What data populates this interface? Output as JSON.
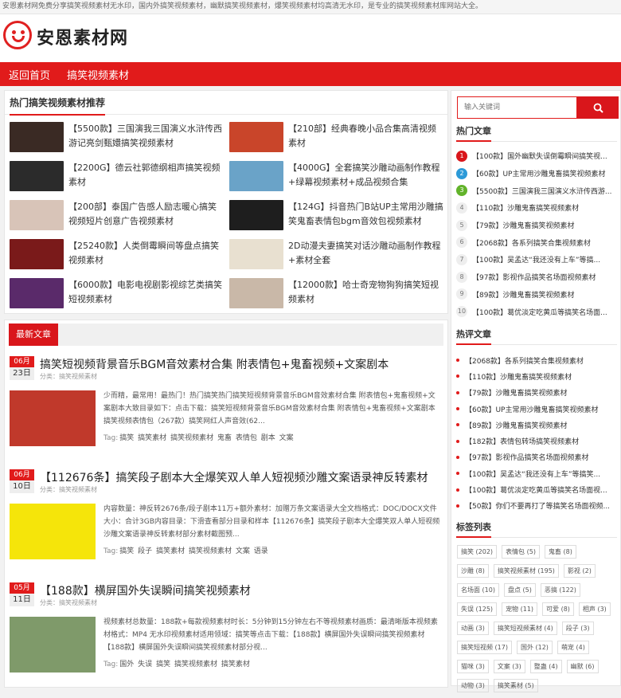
{
  "topbar": {
    "text": "安恩素材网免费分享搞笑视频素材无水印，国内外搞笑视频素材，幽默搞笑视频素材，爆笑视频素材均高清无水印，是专业的搞笑视频素材库网站大全。"
  },
  "header": {
    "logo_text": "安恩素材网"
  },
  "nav": {
    "items": [
      {
        "label": "返回首页"
      },
      {
        "label": "搞笑视频素材"
      }
    ]
  },
  "hot": {
    "title": "热门搞笑视频素材推荐",
    "items": [
      {
        "title": "【5500款】三国演我三国演义水浒传西游记亮剑甄嬛搞笑视频素材",
        "color": "#3a2a24"
      },
      {
        "title": "【210部】经典春晚小品合集高清视频素材",
        "color": "#c9452a"
      },
      {
        "title": "【2200G】德云社郭德纲相声搞笑视频素材",
        "color": "#2b2b2b"
      },
      {
        "title": "【4000G】全套搞笑沙雕动画制作教程+绿幕视频素材+成品视频合集",
        "color": "#6aa3c8"
      },
      {
        "title": "【200部】泰国广告感人励志暖心搞笑视频短片创意广告视频素材",
        "color": "#d8c4b8"
      },
      {
        "title": "【124G】抖音热门B站UP主常用沙雕搞笑鬼畜表情包bgm音效包视频素材",
        "color": "#1e1e1e"
      },
      {
        "title": "【25240款】人类倒霉瞬间等盘点搞笑视频素材",
        "color": "#7a1a1a"
      },
      {
        "title": "2D动漫夫妻搞笑对话沙雕动画制作教程+素材全套",
        "color": "#e8e0d0"
      },
      {
        "title": "【6000款】电影电视剧影视综艺类搞笑短视频素材",
        "color": "#5a2a6a"
      },
      {
        "title": "【12000款】哈士奇宠物狗狗搞笑短视频素材",
        "color": "#c9b8a8"
      }
    ]
  },
  "latest": {
    "title": "最新文章",
    "posts": [
      {
        "month": "06月",
        "day": "23日",
        "title": "搞笑短视频背景音乐BGM音效素材合集 附表情包+鬼畜视频+文案剧本",
        "cat": "分类：搞笑视频素材",
        "excerpt": "少而精，最常用！最热门！热门搞笑热门搞笑短视频背景音乐BGM音效素材合集 附表情包+鬼畜视频+文案剧本大致目录如下：点击下载：搞笑短视频背景音乐BGM音效素材合集 附表情包+鬼畜视频+文案剧本搞笑视频表情包（267款）搞笑网红人声音效(62...",
        "tags_label": "Tag:",
        "tags": [
          "搞笑",
          "搞笑素材",
          "搞笑视频素材",
          "鬼畜",
          "表情包",
          "剧本",
          "文案"
        ],
        "img_color": "#c0392b"
      },
      {
        "month": "06月",
        "day": "10日",
        "title": "【112676条】搞笑段子剧本大全爆笑双人单人短视频沙雕文案语录神反转素材",
        "cat": "分类：搞笑视频素材",
        "excerpt": "内容数量：神反转2676条/段子剧本11万+额外素材：加赠万条文案语录大全文档格式：DOC/DOCX文件大小：合计3GB内容目录：下滑查看部分目录和样本【112676条】搞笑段子剧本大全爆笑双人单人短视频沙雕文案语录神反转素材部分素材截图预...",
        "tags_label": "Tag:",
        "tags": [
          "搞笑",
          "段子",
          "搞笑素材",
          "搞笑视频素材",
          "文案",
          "语录"
        ],
        "img_color": "#f5e50a"
      },
      {
        "month": "05月",
        "day": "11日",
        "title": "【188款】横屏国外失误瞬间搞笑视频素材",
        "cat": "分类：搞笑视频素材",
        "excerpt": "视频素材总数量：188款+每款视频素材时长：5分钟到15分钟左右不等视频素材画质：最清晰版本视频素材格式：MP4 无水印视频素材适用领域：搞笑等点击下载：【188款】横屏国外失误瞬间搞笑视频素材【188款】横屏国外失误瞬间搞笑视频素材部分视...",
        "tags_label": "Tag:",
        "tags": [
          "国外",
          "失误",
          "搞笑",
          "搞笑视频素材",
          "搞笑素材"
        ],
        "img_color": "#7f9a6a"
      }
    ]
  },
  "search": {
    "placeholder": "输入关键词",
    "icon": "search-icon"
  },
  "hot_articles": {
    "title": "热门文章",
    "items": [
      {
        "n": "1",
        "text": "【100款】国外幽默失误倒霉瞬间搞笑视..."
      },
      {
        "n": "2",
        "text": "【60款】UP主常用沙雕鬼畜搞笑视频素材"
      },
      {
        "n": "3",
        "text": "【5500款】三国演我三国演义水浒传西游..."
      },
      {
        "n": "4",
        "text": "【110款】沙雕鬼畜搞笑视频素材"
      },
      {
        "n": "5",
        "text": "【79款】沙雕鬼畜搞笑视频素材"
      },
      {
        "n": "6",
        "text": "【2068款】各系列搞笑合集视频素材"
      },
      {
        "n": "7",
        "text": "【100款】吴孟达“我还没有上车”等搞..."
      },
      {
        "n": "8",
        "text": "【97款】影视作品搞笑名场面视频素材"
      },
      {
        "n": "9",
        "text": "【89款】沙雕鬼畜搞笑视频素材"
      },
      {
        "n": "10",
        "text": "【100款】葛优淡定吃黄瓜等搞笑名场面..."
      }
    ]
  },
  "hot_comments": {
    "title": "热评文章",
    "items": [
      "【2068款】各系列搞笑合集视频素材",
      "【110款】沙雕鬼畜搞笑视频素材",
      "【79款】沙雕鬼畜搞笑视频素材",
      "【60款】UP主常用沙雕鬼畜搞笑视频素材",
      "【89款】沙雕鬼畜搞笑视频素材",
      "【182款】表情包转场搞笑视频素材",
      "【97款】影视作品搞笑名场面视频素材",
      "【100款】吴孟达“我还没有上车”等搞笑...",
      "【100款】葛优淡定吃黄瓜等搞笑名场面视...",
      "【50款】你们不要再打了等搞笑名场面视频..."
    ]
  },
  "tags": {
    "title": "标签列表",
    "items": [
      "搞笑 (202)",
      "表情包 (5)",
      "鬼畜 (8)",
      "沙雕 (8)",
      "搞笑视频素材 (195)",
      "影视 (2)",
      "名场面 (10)",
      "盘点 (5)",
      "恶搞 (122)",
      "失误 (125)",
      "宠物 (11)",
      "可爱 (8)",
      "相声 (3)",
      "动画 (3)",
      "搞笑短视频素材 (4)",
      "段子 (3)",
      "搞笑短视频 (17)",
      "国外 (12)",
      "萌宠 (4)",
      "猫咪 (3)",
      "文案 (3)",
      "整蛊 (4)",
      "幽默 (6)",
      "动物 (3)",
      "搞笑素材 (5)"
    ]
  }
}
